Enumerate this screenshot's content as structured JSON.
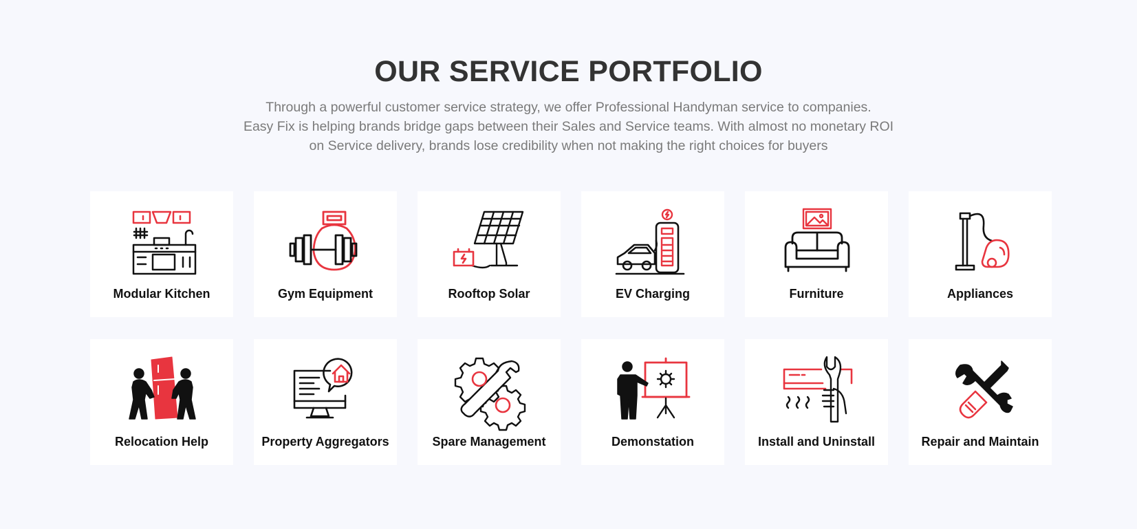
{
  "section": {
    "title": "OUR SERVICE PORTFOLIO",
    "description_lines": [
      "Through a powerful customer service strategy, we offer Professional Handyman service to companies.",
      "Easy Fix is helping brands bridge gaps between their Sales and Service teams. With almost no monetary ROI",
      "on Service delivery, brands lose credibility when not making the right choices for buyers"
    ]
  },
  "colors": {
    "accent": "#e8353f",
    "ink": "#111111",
    "title": "#333333",
    "muted": "#7a7a7a",
    "background": "#f7f8fd",
    "card": "#ffffff"
  },
  "services": [
    {
      "label": "Modular Kitchen",
      "icon": "kitchen-icon"
    },
    {
      "label": "Gym Equipment",
      "icon": "dumbbell-icon"
    },
    {
      "label": "Rooftop Solar",
      "icon": "solar-panel-icon"
    },
    {
      "label": "EV Charging",
      "icon": "ev-charger-icon"
    },
    {
      "label": "Furniture",
      "icon": "sofa-icon"
    },
    {
      "label": "Appliances",
      "icon": "vacuum-cleaner-icon"
    },
    {
      "label": "Relocation Help",
      "icon": "movers-icon"
    },
    {
      "label": "Property Aggregators",
      "icon": "property-monitor-icon"
    },
    {
      "label": "Spare Management",
      "icon": "gears-wrench-icon"
    },
    {
      "label": "Demonstation",
      "icon": "presentation-icon"
    },
    {
      "label": "Install and Uninstall",
      "icon": "ac-wrench-icon"
    },
    {
      "label": "Repair and Maintain",
      "icon": "tools-icon"
    }
  ]
}
